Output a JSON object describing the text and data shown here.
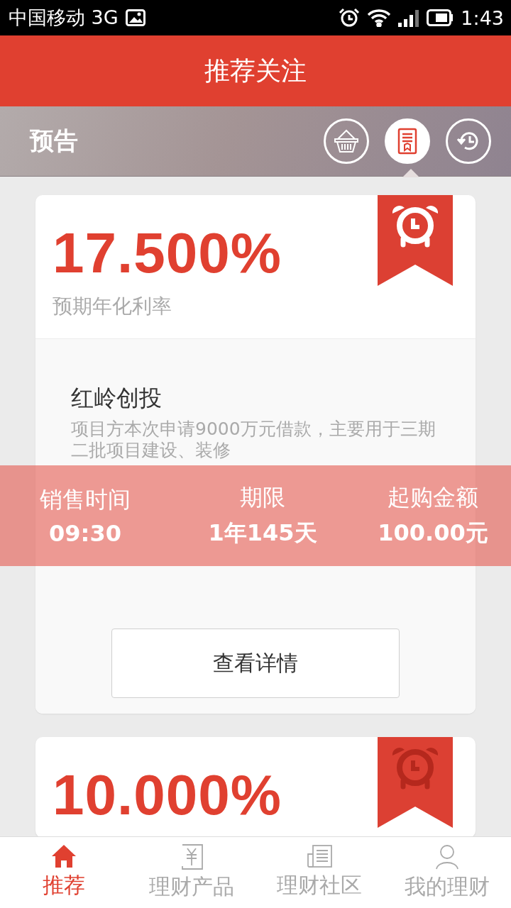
{
  "status_bar": {
    "carrier": "中国移动 3G",
    "time": "1:43"
  },
  "header": {
    "title": "推荐关注"
  },
  "section": {
    "title": "预告",
    "tabs": [
      {
        "kind": "basket",
        "selected": false
      },
      {
        "kind": "document",
        "selected": true
      },
      {
        "kind": "history",
        "selected": false
      }
    ]
  },
  "products": [
    {
      "rate": "17.500%",
      "rate_label": "预期年化利率",
      "alarm_active": true,
      "name": "红岭创投",
      "description": "项目方本次申请9000万元借款，主要用于三期二批项目建设、装修",
      "button": "查看详情"
    },
    {
      "rate": "10.000%",
      "alarm_active": false
    }
  ],
  "sale_band": [
    {
      "label": "销售时间",
      "value": "09:30"
    },
    {
      "label": "期限",
      "value": "1年145天"
    },
    {
      "label": "起购金额",
      "value": "100.00元"
    }
  ],
  "nav": [
    {
      "kind": "home",
      "label": "推荐",
      "selected": true
    },
    {
      "kind": "yuan",
      "label": "理财产品",
      "selected": false
    },
    {
      "kind": "news",
      "label": "理财社区",
      "selected": false
    },
    {
      "kind": "person",
      "label": "我的理财",
      "selected": false
    }
  ]
}
